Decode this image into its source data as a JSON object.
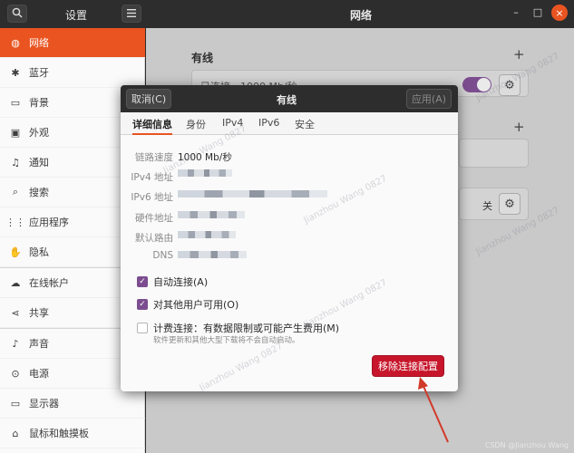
{
  "titlebar": {
    "search_icon": "search-icon",
    "settings_title": "设置",
    "menu_icon": "hamburger-menu-icon",
    "network_title": "网络",
    "minimize": "–",
    "maximize": "□",
    "close": "×"
  },
  "sidebar": {
    "items": [
      {
        "icon": "◍",
        "label": "网络"
      },
      {
        "icon": "✱",
        "label": "蓝牙"
      },
      {
        "icon": "▭",
        "label": "背景"
      },
      {
        "icon": "▣",
        "label": "外观"
      },
      {
        "icon": "♫",
        "label": "通知"
      },
      {
        "icon": "⌕",
        "label": "搜索"
      },
      {
        "icon": "⋮⋮",
        "label": "应用程序"
      },
      {
        "icon": "✋",
        "label": "隐私"
      },
      {
        "icon": "☁",
        "label": "在线帐户"
      },
      {
        "icon": "⋖",
        "label": "共享"
      },
      {
        "icon": "♪",
        "label": "声音"
      },
      {
        "icon": "⊙",
        "label": "电源"
      },
      {
        "icon": "▭",
        "label": "显示器"
      },
      {
        "icon": "⌂",
        "label": "鼠标和触摸板"
      }
    ]
  },
  "main": {
    "wired_title": "有线",
    "plus": "+",
    "wired_status_partial": "已连接 - 1000 Mb/秒",
    "off_label": "关",
    "gear": "⚙"
  },
  "dialog": {
    "cancel_label": "取消(C)",
    "title": "有线",
    "apply_label": "应用(A)",
    "tabs": [
      {
        "label": "详细信息",
        "active": true
      },
      {
        "label": "身份",
        "active": false
      },
      {
        "label": "IPv4",
        "active": false
      },
      {
        "label": "IPv6",
        "active": false
      },
      {
        "label": "安全",
        "active": false
      }
    ],
    "details": {
      "link_speed_label": "链路速度",
      "link_speed_value": "1000 Mb/秒",
      "ipv4_label": "IPv4 地址",
      "ipv6_label": "IPv6 地址",
      "hw_label": "硬件地址",
      "route_label": "默认路由",
      "dns_label": "DNS"
    },
    "checkboxes": [
      {
        "label": "自动连接(A)",
        "checked": true
      },
      {
        "label": "对其他用户可用(O)",
        "checked": true
      },
      {
        "label": "计费连接：有数据限制或可能产生费用(M)",
        "checked": false
      }
    ],
    "metered_sub": "软件更新和其他大型下载将不会自动启动。",
    "remove_label": "移除连接配置"
  },
  "watermark": "Jianzhou Wang 0827",
  "credit": "CSDN @Jianzhou Wang",
  "colors": {
    "accent": "#e95420",
    "toggle": "#7b4d8f",
    "destructive": "#c7162b",
    "arrow": "#d23a2a"
  }
}
